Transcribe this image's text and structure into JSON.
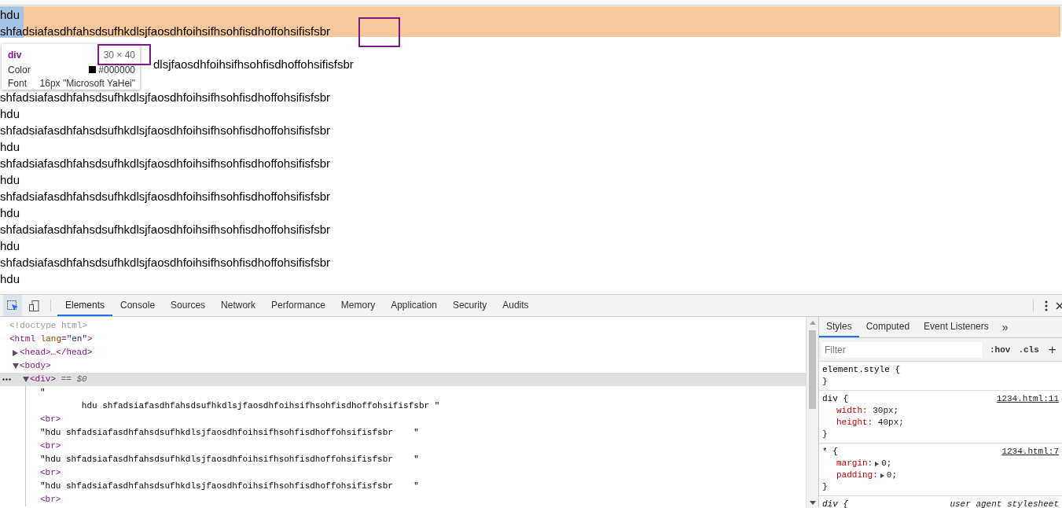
{
  "page": {
    "lines": [
      {
        "kind": "text",
        "text": "hdu"
      },
      {
        "kind": "text",
        "text": "shfadsiafasdhfahsdsufhkdlsjfaosdhfoihsifhsohfisdhoffohsifisfsbr"
      },
      {
        "kind": "covered"
      },
      {
        "kind": "partial",
        "text": "dlsjfaosdhfoihsifhsohfisdhoffohsifisfsbr"
      },
      {
        "kind": "covered"
      },
      {
        "kind": "text",
        "text": "shfadsiafasdhfahsdsufhkdlsjfaosdhfoihsifhsohfisdhoffohsifisfsbr"
      },
      {
        "kind": "text",
        "text": "hdu"
      },
      {
        "kind": "text",
        "text": "shfadsiafasdhfahsdsufhkdlsjfaosdhfoihsifhsohfisdhoffohsifisfsbr"
      },
      {
        "kind": "text",
        "text": "hdu"
      },
      {
        "kind": "text",
        "text": "shfadsiafasdhfahsdsufhkdlsjfaosdhfoihsifhsohfisdhoffohsifisfsbr"
      },
      {
        "kind": "text",
        "text": "hdu"
      },
      {
        "kind": "text",
        "text": "shfadsiafasdhfahsdsufhkdlsjfaosdhfoihsifhsohfisdhoffohsifisfsbr"
      },
      {
        "kind": "text",
        "text": "hdu"
      },
      {
        "kind": "text",
        "text": "shfadsiafasdhfahsdsufhkdlsjfaosdhfoihsifhsohfisdhoffohsifisfsbr"
      },
      {
        "kind": "text",
        "text": "hdu"
      },
      {
        "kind": "text",
        "text": "shfadsiafasdhfahsdsufhkdlsjfaosdhfoihsifhsohfisdhoffohsifisfsbr"
      },
      {
        "kind": "text",
        "text": "hdu"
      }
    ],
    "inspect_tooltip": {
      "tag": "div",
      "size": "30 × 40",
      "rows": [
        {
          "label": "Color",
          "value": "#000000",
          "color": "#000000"
        },
        {
          "label": "Font",
          "value": "16px \"Microsoft YaHei\""
        }
      ]
    }
  },
  "devtools": {
    "tools": [
      {
        "kind": "inspect",
        "active": true
      },
      {
        "kind": "device",
        "active": false
      }
    ],
    "tabs": [
      {
        "label": "Elements",
        "selected": true
      },
      {
        "label": "Console",
        "selected": false
      },
      {
        "label": "Sources",
        "selected": false
      },
      {
        "label": "Network",
        "selected": false
      },
      {
        "label": "Performance",
        "selected": false
      },
      {
        "label": "Memory",
        "selected": false
      },
      {
        "label": "Application",
        "selected": false
      },
      {
        "label": "Security",
        "selected": false
      },
      {
        "label": "Audits",
        "selected": false
      }
    ],
    "elements": {
      "tree": [
        {
          "kind": "doctype",
          "open": "<!doctype html>"
        },
        {
          "kind": "element",
          "open": "<html lang=\"en\">",
          "children": [
            {
              "kind": "element",
              "open": "<head>…</head>",
              "expanded": false
            },
            {
              "kind": "element",
              "open": "<body>",
              "expanded": true,
              "children": [
                {
                  "kind": "element",
                  "open": "<div>",
                  "suffix": "== $0",
                  "expanded": true,
                  "selected": true,
                  "children": [
                    {
                      "kind": "text",
                      "lines": [
                        "\"",
                        "        hdu shfadsiafasdhfahsdsufhkdlsjfaosdhfoihsifhsohfisdhoffohsifisfsbr \""
                      ]
                    },
                    {
                      "kind": "element",
                      "open": "<br>"
                    },
                    {
                      "kind": "text",
                      "lines": [
                        "\"hdu shfadsiafasdhfahsdsufhkdlsjfaosdhfoihsifhsohfisdhoffohsifisfsbr    \""
                      ]
                    },
                    {
                      "kind": "element",
                      "open": "<br>"
                    },
                    {
                      "kind": "text",
                      "lines": [
                        "\"hdu shfadsiafasdhfahsdsufhkdlsjfaosdhfoihsifhsohfisdhoffohsifisfsbr    \""
                      ]
                    },
                    {
                      "kind": "element",
                      "open": "<br>"
                    },
                    {
                      "kind": "text",
                      "lines": [
                        "\"hdu shfadsiafasdhfahsdsufhkdlsjfaosdhfoihsifhsohfisdhoffohsifisfsbr    \""
                      ]
                    },
                    {
                      "kind": "element",
                      "open": "<br>"
                    }
                  ]
                }
              ]
            }
          ]
        }
      ]
    },
    "styles": {
      "tabs": [
        {
          "label": "Styles",
          "selected": true
        },
        {
          "label": "Computed",
          "selected": false
        },
        {
          "label": "Event Listeners",
          "selected": false
        }
      ],
      "more": "»",
      "filter": {
        "placeholder": "Filter"
      },
      "toggles": [
        ":hov",
        ".cls"
      ],
      "add": "+",
      "rules": [
        {
          "kind": "author",
          "selector": "element.style {",
          "close": "}"
        },
        {
          "kind": "author",
          "selector": "div {",
          "source": "1234.html:11",
          "properties": [
            {
              "name": "width:",
              "value": "30px;"
            },
            {
              "name": "height:",
              "value": "40px;"
            }
          ],
          "close": "}"
        },
        {
          "kind": "author",
          "selector": "* {",
          "source": "1234.html:7",
          "properties": [
            {
              "name": "margin:",
              "value": "0;",
              "expandable": true
            },
            {
              "name": "padding:",
              "value": "0;",
              "expandable": true
            }
          ],
          "close": "}"
        },
        {
          "kind": "user_agent",
          "selector": "div {",
          "source": "user agent stylesheet"
        }
      ]
    }
  }
}
